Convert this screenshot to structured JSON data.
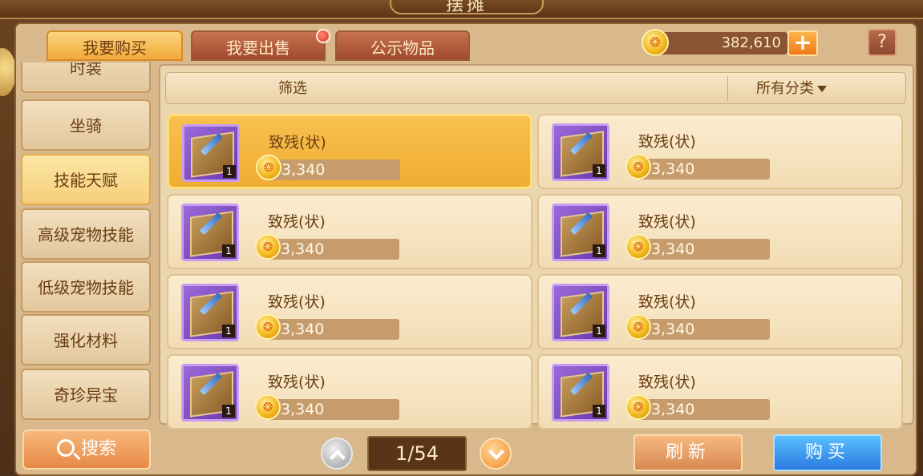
{
  "window": {
    "title": "摆摊"
  },
  "tabs": [
    {
      "label": "我要购买",
      "active": true
    },
    {
      "label": "我要出售",
      "active": false,
      "has_notification": true
    },
    {
      "label": "公示物品",
      "active": false
    }
  ],
  "currency": {
    "amount": "382,610",
    "coin_glyph": "❂",
    "add_label": "+"
  },
  "help": {
    "label": "?"
  },
  "sidebar": {
    "items": [
      {
        "label": "时装"
      },
      {
        "label": "坐骑"
      },
      {
        "label": "技能天赋",
        "active": true
      },
      {
        "label": "高级宠物技能"
      },
      {
        "label": "低级宠物技能"
      },
      {
        "label": "强化材料"
      },
      {
        "label": "奇珍异宝"
      }
    ]
  },
  "search": {
    "label": "搜索"
  },
  "filter": {
    "label": "筛选",
    "category": "所有分类"
  },
  "items": [
    {
      "name": "致残(状)",
      "price": "3,340",
      "count": "1",
      "selected": true
    },
    {
      "name": "致残(状)",
      "price": "3,340",
      "count": "1"
    },
    {
      "name": "致残(状)",
      "price": "3,340",
      "count": "1"
    },
    {
      "name": "致残(状)",
      "price": "3,340",
      "count": "1"
    },
    {
      "name": "致残(状)",
      "price": "3,340",
      "count": "1"
    },
    {
      "name": "致残(状)",
      "price": "3,340",
      "count": "1"
    },
    {
      "name": "致残(状)",
      "price": "3,340",
      "count": "1"
    },
    {
      "name": "致残(状)",
      "price": "3,340",
      "count": "1"
    }
  ],
  "pager": {
    "page": "1/54"
  },
  "actions": {
    "refresh": "刷新",
    "buy": "购买"
  },
  "colors": {
    "accent": "#f0ad32",
    "buy": "#2a7ae0",
    "notify": "#e02a1a"
  }
}
